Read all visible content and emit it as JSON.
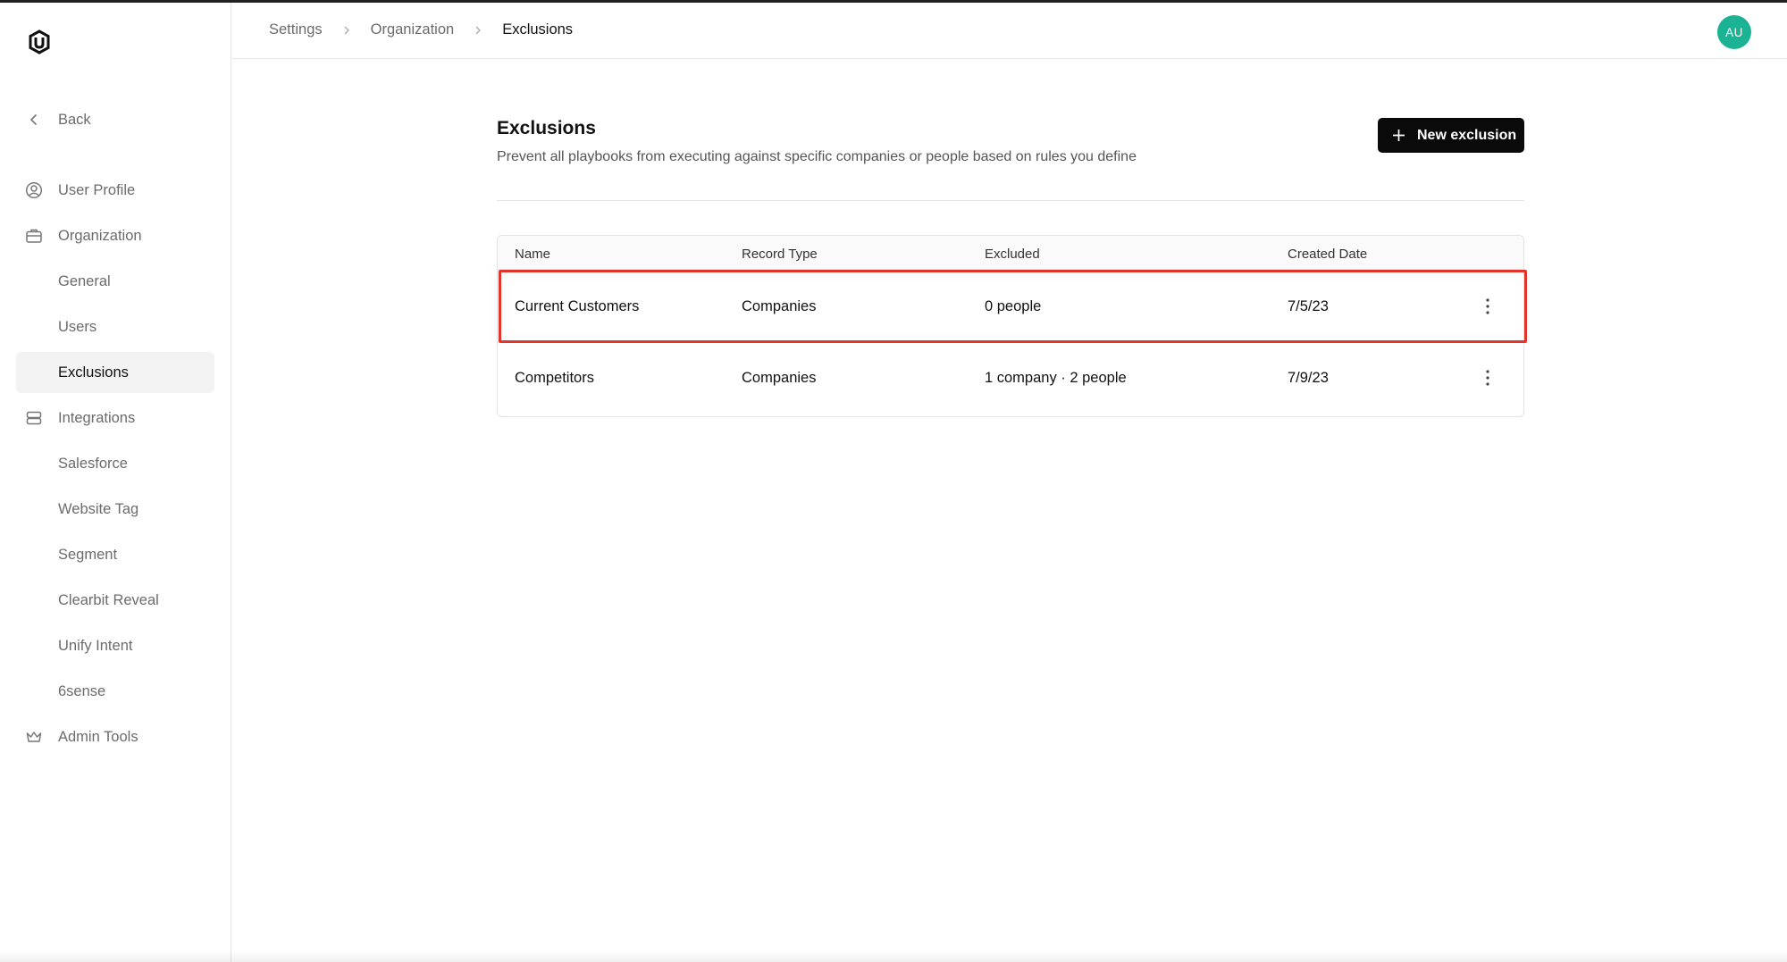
{
  "sidebar": {
    "back_label": "Back",
    "items": [
      {
        "label": "User Profile",
        "icon": "user-circle-icon"
      },
      {
        "label": "Organization",
        "icon": "briefcase-icon"
      },
      {
        "label": "General"
      },
      {
        "label": "Users"
      },
      {
        "label": "Exclusions",
        "active": true
      },
      {
        "label": "Integrations",
        "icon": "server-icon"
      },
      {
        "label": "Salesforce"
      },
      {
        "label": "Website Tag"
      },
      {
        "label": "Segment"
      },
      {
        "label": "Clearbit Reveal"
      },
      {
        "label": "Unify Intent"
      },
      {
        "label": "6sense"
      },
      {
        "label": "Admin Tools",
        "icon": "crown-icon"
      }
    ]
  },
  "header": {
    "breadcrumb": [
      "Settings",
      "Organization",
      "Exclusions"
    ],
    "avatar_initials": "AU",
    "avatar_color": "#1bb394"
  },
  "main": {
    "title": "Exclusions",
    "subtitle": "Prevent all playbooks from executing against specific companies or people based on rules you define",
    "new_button_label": "New exclusion",
    "table": {
      "columns": [
        "Name",
        "Record Type",
        "Excluded",
        "Created Date"
      ],
      "rows": [
        {
          "name": "Current Customers",
          "record_type": "Companies",
          "excluded": "0 people",
          "created": "7/5/23"
        },
        {
          "name": "Competitors",
          "record_type": "Companies",
          "excluded": "1 company · 2 people",
          "created": "7/9/23"
        }
      ]
    }
  },
  "highlight_color": "#e2342a"
}
